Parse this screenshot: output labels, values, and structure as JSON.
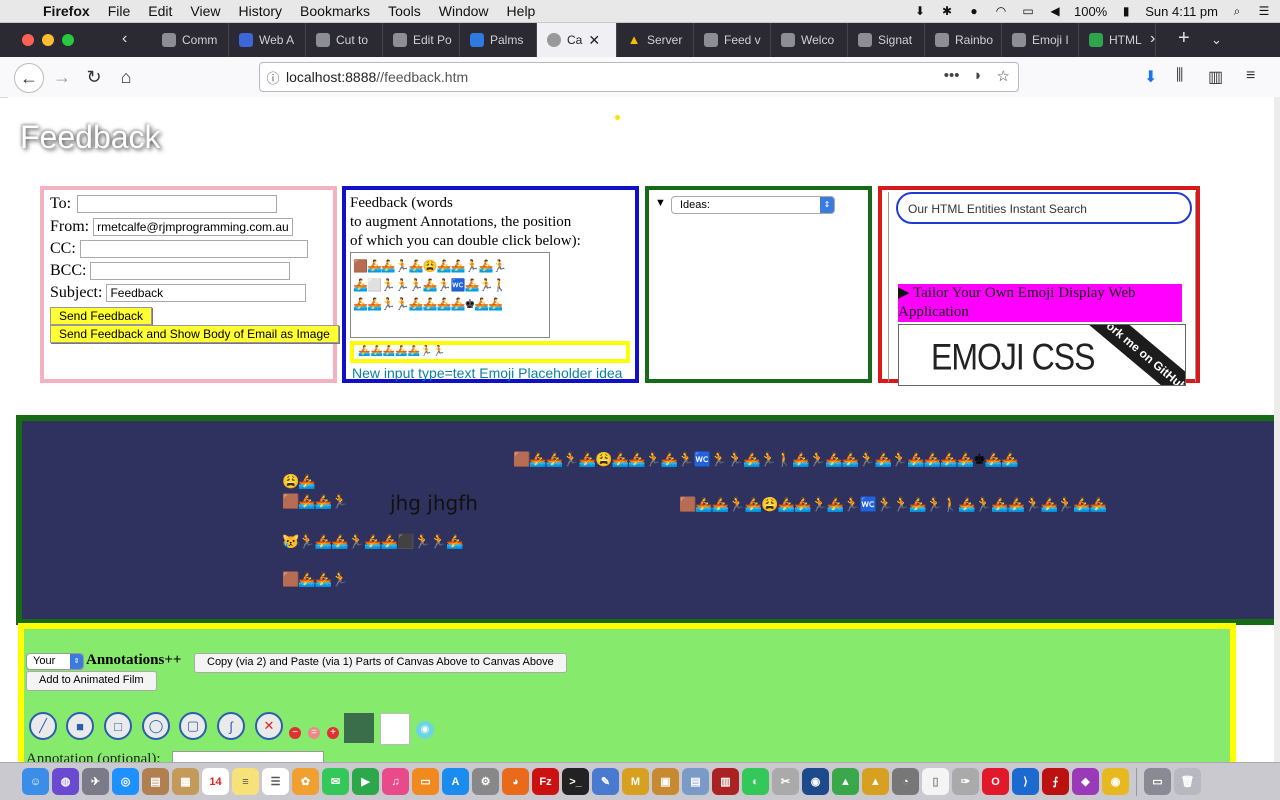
{
  "menubar": {
    "app": "Firefox",
    "items": [
      "File",
      "Edit",
      "View",
      "History",
      "Bookmarks",
      "Tools",
      "Window",
      "Help"
    ],
    "battery": "100%",
    "clock": "Sun 4:11 pm"
  },
  "tabs": [
    {
      "label": "Comm"
    },
    {
      "label": "Web A"
    },
    {
      "label": "Cut to"
    },
    {
      "label": "Edit Po"
    },
    {
      "label": "Palms"
    },
    {
      "label": "Ca",
      "active": true
    },
    {
      "label": "Server"
    },
    {
      "label": "Feed v"
    },
    {
      "label": "Welco"
    },
    {
      "label": "Signat"
    },
    {
      "label": "Rainbo"
    },
    {
      "label": "Emoji I"
    },
    {
      "label": "HTML"
    }
  ],
  "url": {
    "host": "localhost:8888",
    "path": "//feedback.htm"
  },
  "page": {
    "title": "Feedback",
    "form": {
      "to_label": "To:",
      "to_value": "",
      "from_label": "From:",
      "from_value": "rmetcalfe@rjmprogramming.com.au",
      "cc_label": "CC:",
      "cc_value": "",
      "bcc_label": "BCC:",
      "bcc_value": "",
      "subject_label": "Subject:",
      "subject_value": "Feedback",
      "send_button": "Send Feedback",
      "send_image_button": "Send Feedback and Show Body of Email as Image"
    },
    "feedback_panel": {
      "text": "Feedback (words\nto augment Annotations, the position\nof which you can double click below):",
      "emoji_rows": [
        "🟫🚣🚣🏃🚣😩🚣🚣🏃🚣🏃",
        "🚣⬜🏃🏃🏃🚣🏃🚾🚣🏃🚶",
        "🚣🚣🏃🏃🚣🚣🚣🚣♚🚣🚣"
      ],
      "placeholder_emoji": "🚣🚣🚣🚣🚣🏃🏃",
      "placeholder_idea": "New input type=text Emoji Placeholder idea"
    },
    "ideas": {
      "select_value": "Ideas:"
    },
    "entities": {
      "search_placeholder": "Our HTML Entities Instant Search",
      "tailor_text": "▶ Tailor Your Own Emoji Display Web Application",
      "emoji_css": "EMOJI CSS",
      "ribbon": "Fork me on GitHub"
    },
    "canvas": {
      "rows": [
        "🟫🚣🚣🏃🚣😩🚣🚣🏃🚣🏃🚾🏃🏃🚣🏃🚶🚣🏃🚣🚣🏃🚣🏃🚣🚣🚣🚣♚🚣🚣",
        "😩🚣",
        "🟫🚣🚣🏃",
        "🟫🚣🚣🏃🚣😩🚣🚣🏃🚣🏃🚾🏃🏃🚣🏃🚶🚣🏃🚣🚣🏃🚣🏃🚣🚣",
        "😿🏃🚣🚣🏃🚣🚣⬛🏃🏃🚣",
        "🟫🚣🚣🏃"
      ],
      "annotation_text": "jhg jhgfh"
    },
    "annotations": {
      "select_value": "Your",
      "heading": "Annotations++",
      "copy_button": "Copy (via 2) and Paste (via 1) Parts of Canvas Above to Canvas Above",
      "film_button": "Add to Animated Film",
      "annotation_label": "Annotation (optional):"
    }
  },
  "colors": {
    "navy_canvas": "#2f325e",
    "green_area": "#86ea6c",
    "pink_border": "#f3b2c0",
    "blue_border": "#1010c8",
    "green_border": "#176b17",
    "red_border": "#d81919"
  }
}
